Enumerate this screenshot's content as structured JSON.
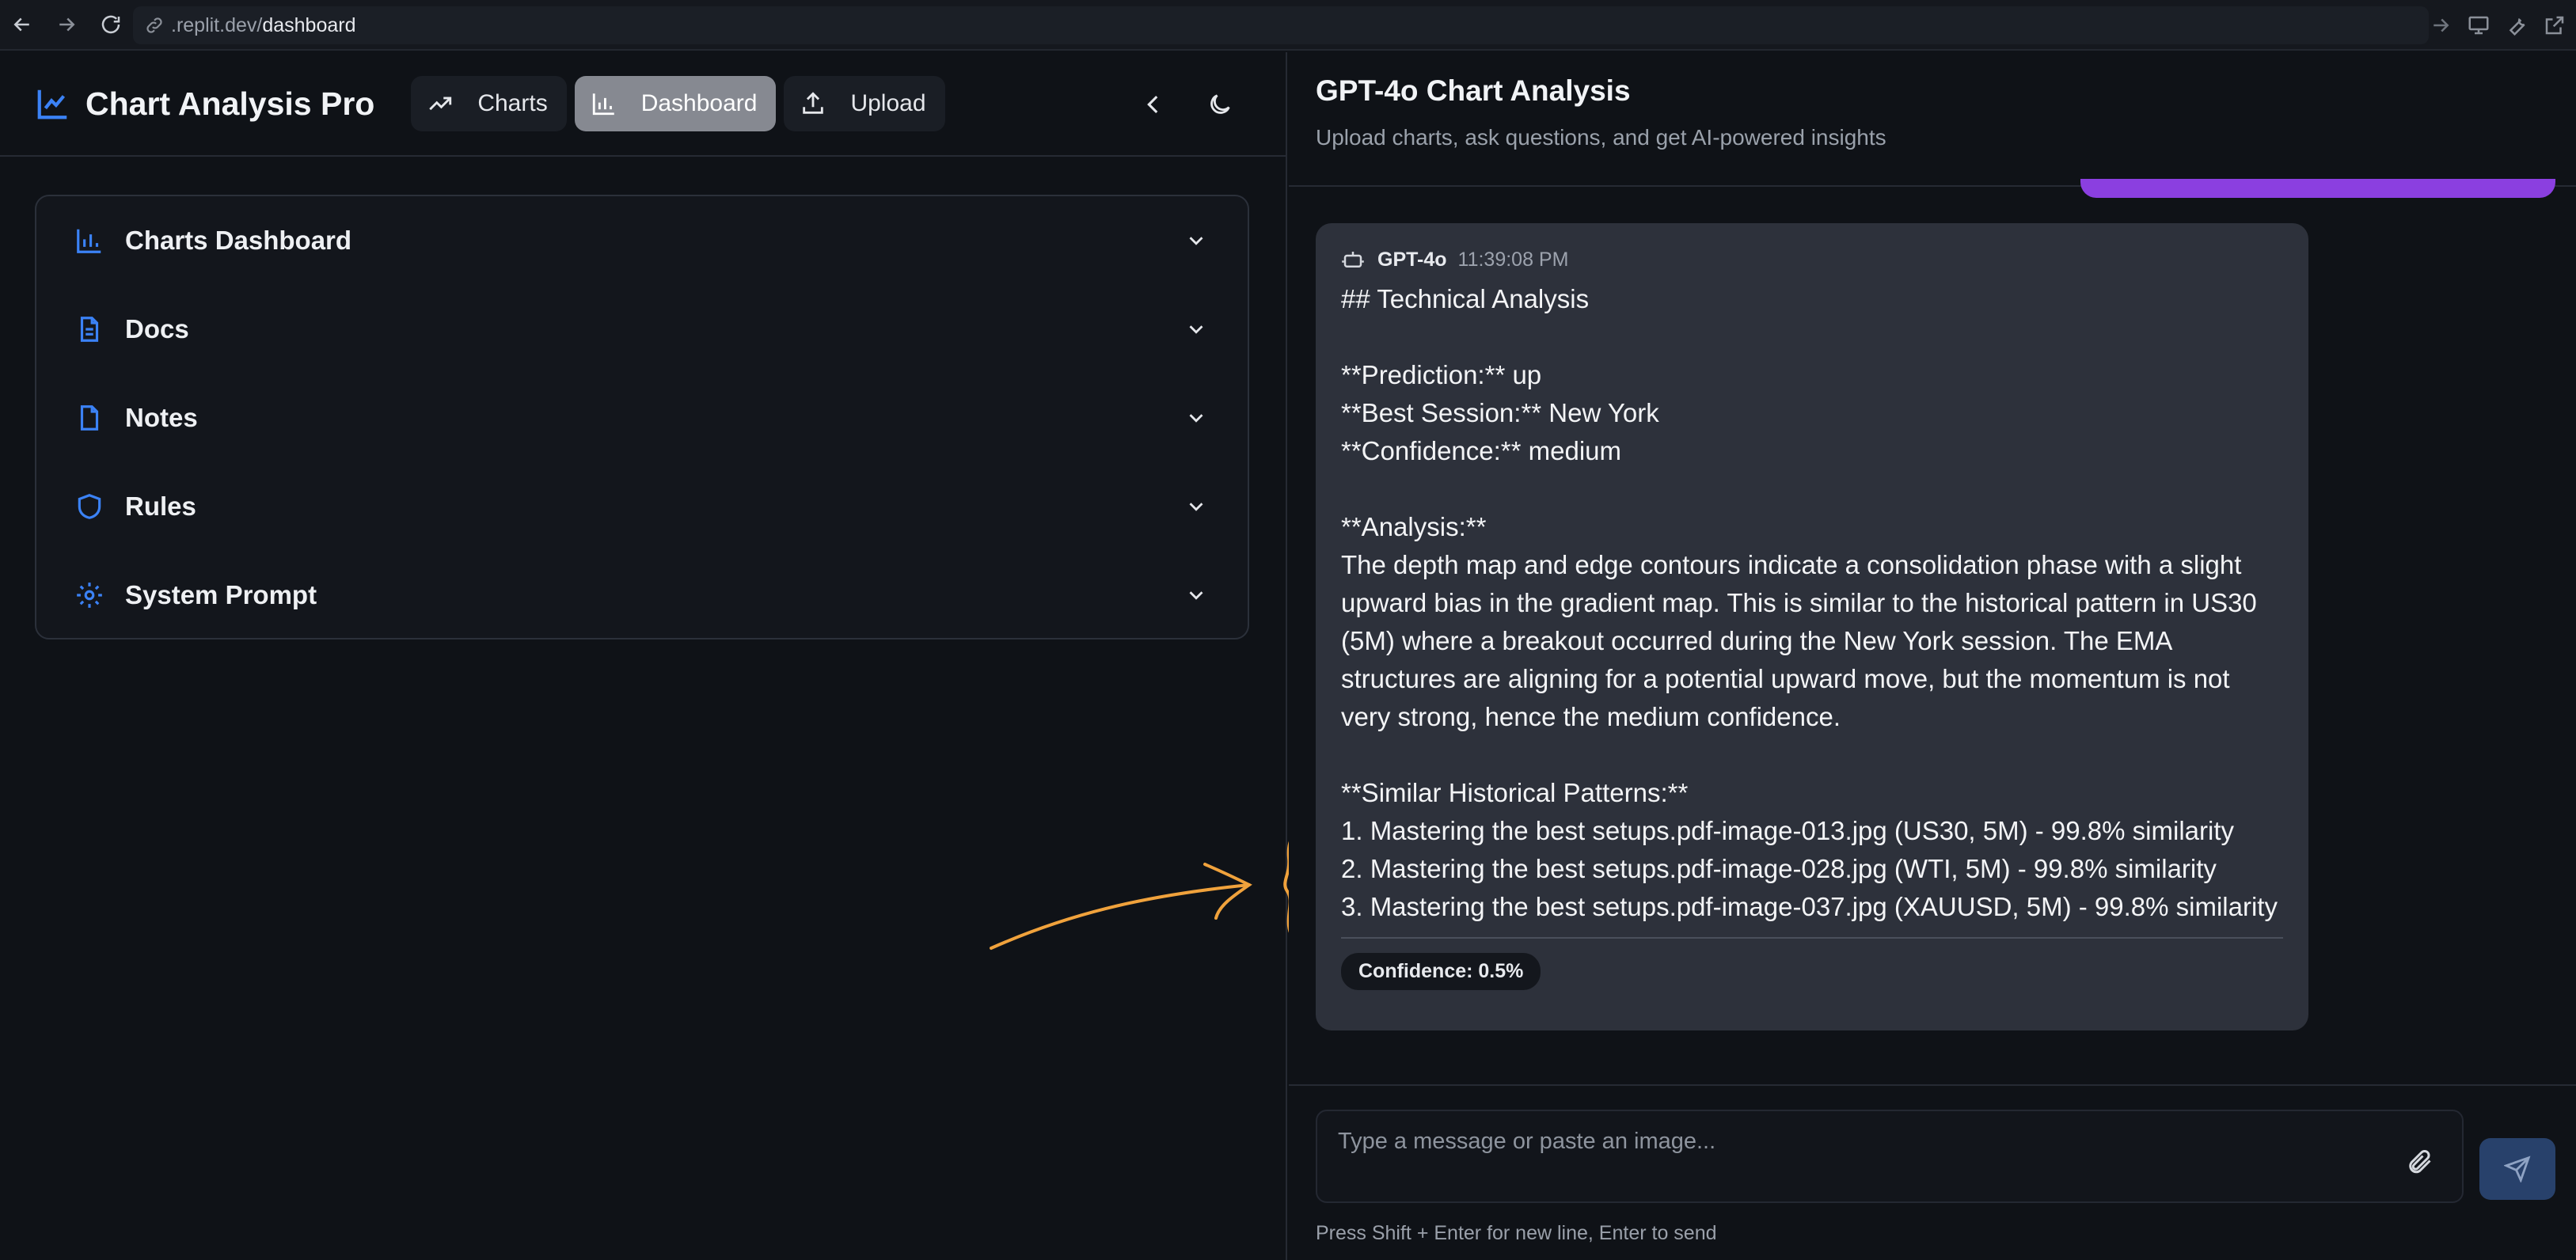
{
  "browser": {
    "url_prefix": ".replit.dev/",
    "url_path": "dashboard"
  },
  "app": {
    "title": "Chart Analysis Pro",
    "nav": [
      {
        "label": "Charts",
        "icon": "trending-up-icon",
        "active": false
      },
      {
        "label": "Dashboard",
        "icon": "bar-chart-icon",
        "active": true
      },
      {
        "label": "Upload",
        "icon": "upload-icon",
        "active": false
      }
    ]
  },
  "sidebar": {
    "sections": [
      {
        "label": "Charts Dashboard",
        "icon": "bar-chart-icon"
      },
      {
        "label": "Docs",
        "icon": "document-icon"
      },
      {
        "label": "Notes",
        "icon": "file-icon"
      },
      {
        "label": "Rules",
        "icon": "shield-icon"
      },
      {
        "label": "System Prompt",
        "icon": "gear-icon"
      }
    ]
  },
  "chat": {
    "title": "GPT-4o Chart Analysis",
    "subtitle": "Upload charts, ask questions, and get AI-powered insights",
    "message": {
      "sender": "GPT-4o",
      "time": "11:39:08 PM",
      "body": "## Technical Analysis\n\n**Prediction:** up\n**Best Session:** New York\n**Confidence:** medium\n\n**Analysis:**\nThe depth map and edge contours indicate a consolidation phase with a slight upward bias in the gradient map. This is similar to the historical pattern in US30 (5M) where a breakout occurred during the New York session. The EMA structures are aligning for a potential upward move, but the momentum is not very strong, hence the medium confidence.\n\n**Similar Historical Patterns:**\n1. Mastering the best setups.pdf-image-013.jpg (US30, 5M) - 99.8% similarity\n2. Mastering the best setups.pdf-image-028.jpg (WTI, 5M) - 99.8% similarity\n3. Mastering the best setups.pdf-image-037.jpg (XAUUSD, 5M) - 99.8% similarity",
      "confidence_badge": "Confidence: 0.5%"
    },
    "input_placeholder": "Type a message or paste an image...",
    "hint": "Press Shift + Enter for new line, Enter to send"
  },
  "colors": {
    "accent_blue": "#3b82f6",
    "accent_purple": "#8b3fe0",
    "annotation_orange": "#f0a23c"
  }
}
